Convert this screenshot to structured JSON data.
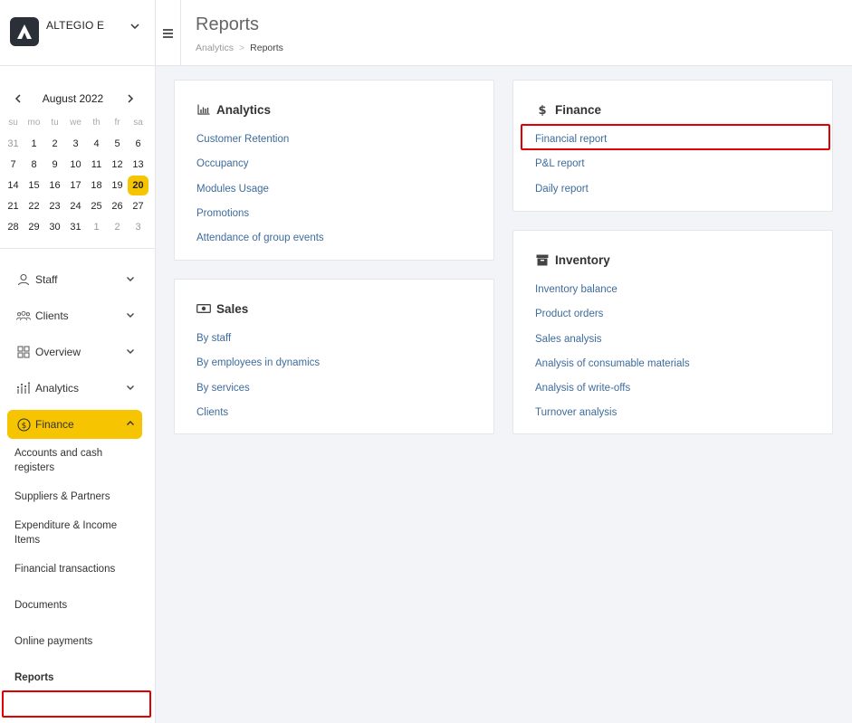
{
  "brand": {
    "name": "ALTEGIO E"
  },
  "calendar": {
    "month": "August 2022",
    "weekdays": [
      "su",
      "mo",
      "tu",
      "we",
      "th",
      "fr",
      "sa"
    ],
    "weeks": [
      [
        "31",
        "1",
        "2",
        "3",
        "4",
        "5",
        "6"
      ],
      [
        "7",
        "8",
        "9",
        "10",
        "11",
        "12",
        "13"
      ],
      [
        "14",
        "15",
        "16",
        "17",
        "18",
        "19",
        "20"
      ],
      [
        "21",
        "22",
        "23",
        "24",
        "25",
        "26",
        "27"
      ],
      [
        "28",
        "29",
        "30",
        "31",
        "1",
        "2",
        "3"
      ]
    ],
    "today": "20"
  },
  "nav": {
    "staff": "Staff",
    "clients": "Clients",
    "overview": "Overview",
    "analytics": "Analytics",
    "finance": "Finance"
  },
  "finance_sub": {
    "accounts": "Accounts and cash registers",
    "suppliers": "Suppliers & Partners",
    "expenditure": "Expenditure & Income Items",
    "transactions": "Financial transactions",
    "documents": "Documents",
    "online_payments": "Online payments",
    "reports": "Reports"
  },
  "header": {
    "title": "Reports",
    "breadcrumb_root": "Analytics",
    "breadcrumb_sep": ">",
    "breadcrumb_current": "Reports"
  },
  "cards": {
    "analytics": {
      "title": "Analytics",
      "links": [
        "Customer Retention",
        "Occupancy",
        "Modules Usage",
        "Promotions",
        "Attendance of group events"
      ]
    },
    "sales": {
      "title": "Sales",
      "links": [
        "By staff",
        "By employees in dynamics",
        "By services",
        "Clients"
      ]
    },
    "finance": {
      "title": "Finance",
      "links": [
        "Financial report",
        "P&L report",
        "Daily report"
      ]
    },
    "inventory": {
      "title": "Inventory",
      "links": [
        "Inventory balance",
        "Product orders",
        "Sales analysis",
        "Analysis of consumable materials",
        "Analysis of write-offs",
        "Turnover analysis"
      ]
    }
  },
  "colors": {
    "accent": "#f6c400",
    "link": "#3e6b9d",
    "highlight": "#e00000"
  }
}
